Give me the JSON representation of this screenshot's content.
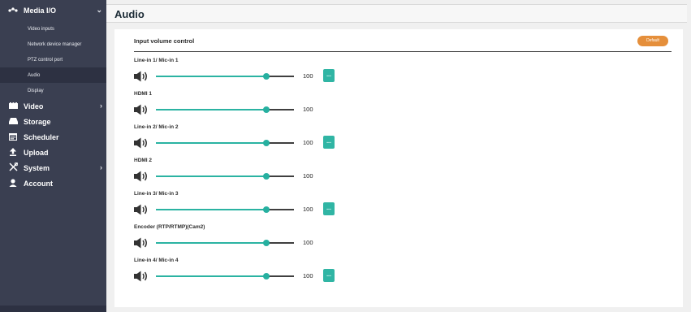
{
  "sidebar": {
    "top": {
      "label": "Media I/O",
      "icon": "media-io-icon"
    },
    "sub_items": [
      {
        "label": "Video inputs",
        "active": false
      },
      {
        "label": "Network device manager",
        "active": false
      },
      {
        "label": "PTZ control port",
        "active": false
      },
      {
        "label": "Audio",
        "active": true
      },
      {
        "label": "Display",
        "active": false
      }
    ],
    "items": [
      {
        "label": "Video",
        "icon": "video-icon",
        "has_submenu": true
      },
      {
        "label": "Storage",
        "icon": "storage-icon",
        "has_submenu": false
      },
      {
        "label": "Scheduler",
        "icon": "calendar-icon",
        "has_submenu": false
      },
      {
        "label": "Upload",
        "icon": "upload-icon",
        "has_submenu": false
      },
      {
        "label": "System",
        "icon": "tools-icon",
        "has_submenu": true
      },
      {
        "label": "Account",
        "icon": "user-icon",
        "has_submenu": false
      }
    ]
  },
  "header": {
    "title": "Audio"
  },
  "card": {
    "title": "Input volume control",
    "default_label": "Default",
    "more_label": "..."
  },
  "channels": [
    {
      "label": "Line-in 1/ Mic-in 1",
      "value": "100",
      "level": 0.8,
      "has_button": true
    },
    {
      "label": "HDMI 1",
      "value": "100",
      "level": 0.8,
      "has_button": false
    },
    {
      "label": "Line-in 2/ Mic-in 2",
      "value": "100",
      "level": 0.8,
      "has_button": true
    },
    {
      "label": "HDMI 2",
      "value": "100",
      "level": 0.8,
      "has_button": false
    },
    {
      "label": "Line-in 3/ Mic-in 3",
      "value": "100",
      "level": 0.8,
      "has_button": true
    },
    {
      "label": "Encoder (RTP/RTMP)(Cam2)",
      "value": "100",
      "level": 0.8,
      "has_button": false
    },
    {
      "label": "Line-in 4/ Mic-in 4",
      "value": "100",
      "level": 0.8,
      "has_button": true
    }
  ],
  "colors": {
    "sidebar_bg": "#3a3f51",
    "accent": "#2bb3a2",
    "default_button": "#e58f3b"
  }
}
